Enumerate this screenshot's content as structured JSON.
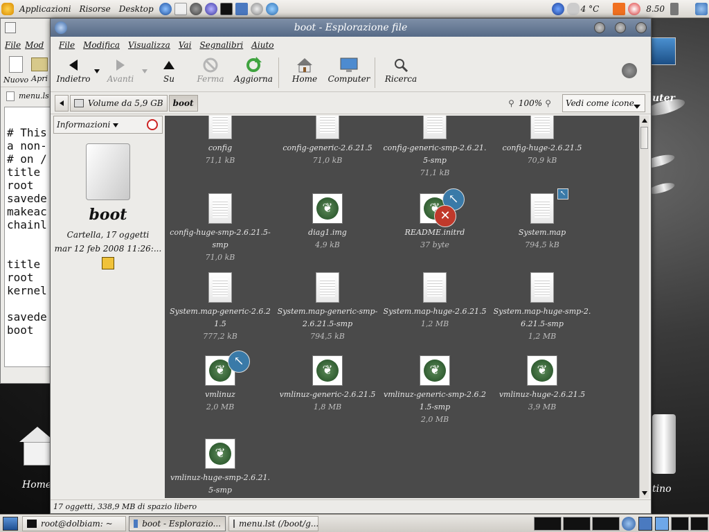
{
  "top_panel": {
    "menus": [
      "Applicazioni",
      "Risorse",
      "Desktop"
    ],
    "weather": "4 °C",
    "clock": "8.50"
  },
  "desktop": {
    "home_label": "Home",
    "trash_label": "tino",
    "computer_label": "uter"
  },
  "editor_window": {
    "menus": [
      "File",
      "Mod"
    ],
    "toolbar": [
      "Nuovo",
      "Apri"
    ],
    "tab": "menu.ls",
    "lines": [
      "",
      "# This",
      "a non-",
      "# on /",
      "title",
      "root",
      "savede",
      "makeac",
      "chainl",
      "",
      "",
      "title",
      "root",
      "kernel",
      "",
      "savede",
      "boot"
    ]
  },
  "window": {
    "title": "boot - Esplorazione file",
    "menus": [
      "File",
      "Modifica",
      "Visualizza",
      "Vai",
      "Segnalibri",
      "Aiuto"
    ],
    "toolbar": {
      "back": "Indietro",
      "forward": "Avanti",
      "up": "Su",
      "stop": "Ferma",
      "reload": "Aggiorna",
      "home": "Home",
      "computer": "Computer",
      "search": "Ricerca"
    },
    "location": {
      "volume": "Volume da 5,9 GB",
      "current": "boot",
      "zoom": "100%",
      "view_mode": "Vedi come icone"
    },
    "sidebar": {
      "header": "Informazioni",
      "folder_name": "boot",
      "folder_info": "Cartella, 17 oggetti",
      "folder_date": "mar 12 feb 2008 11:26:..."
    },
    "status": "17 oggetti, 338,9 MB di spazio libero"
  },
  "files": [
    {
      "name": "config",
      "size": "71,1 kB",
      "icon": "text-file-icon"
    },
    {
      "name": "config-generic-2.6.21.5",
      "size": "71,0 kB",
      "icon": "text-file-icon"
    },
    {
      "name": "config-generic-smp-2.6.21.5-smp",
      "size": "71,1 kB",
      "icon": "text-file-icon"
    },
    {
      "name": "config-huge-2.6.21.5",
      "size": "70,9 kB",
      "icon": "text-file-icon"
    },
    {
      "name": "config-huge-smp-2.6.21.5-smp",
      "size": "71,0 kB",
      "icon": "text-file-icon"
    },
    {
      "name": "diag1.img",
      "size": "4,9 kB",
      "icon": "gnu-file-icon"
    },
    {
      "name": "README.initrd",
      "size": "37 byte",
      "icon": "gnu-file-icon"
    },
    {
      "name": "System.map",
      "size": "794,5 kB",
      "icon": "text-file-icon"
    },
    {
      "name": "System.map-generic-2.6.21.5",
      "size": "777,2 kB",
      "icon": "text-file-icon"
    },
    {
      "name": "System.map-generic-smp-2.6.21.5-smp",
      "size": "794,5 kB",
      "icon": "text-file-icon"
    },
    {
      "name": "System.map-huge-2.6.21.5",
      "size": "1,2 MB",
      "icon": "text-file-icon"
    },
    {
      "name": "System.map-huge-smp-2.6.21.5-smp",
      "size": "1,2 MB",
      "icon": "text-file-icon"
    },
    {
      "name": "vmlinuz",
      "size": "2,0 MB",
      "icon": "gnu-file-icon"
    },
    {
      "name": "vmlinuz-generic-2.6.21.5",
      "size": "1,8 MB",
      "icon": "gnu-file-icon"
    },
    {
      "name": "vmlinuz-generic-smp-2.6.21.5-smp",
      "size": "2,0 MB",
      "icon": "gnu-file-icon"
    },
    {
      "name": "vmlinuz-huge-2.6.21.5",
      "size": "3,9 MB",
      "icon": "gnu-file-icon"
    },
    {
      "name": "vmlinuz-huge-smp-2.6.21.5-smp",
      "size": "",
      "icon": "gnu-file-icon"
    }
  ],
  "taskbar": {
    "tasks": [
      "root@dolbiam: ~",
      "boot - Esplorazio...",
      "menu.lst (/boot/g..."
    ]
  }
}
